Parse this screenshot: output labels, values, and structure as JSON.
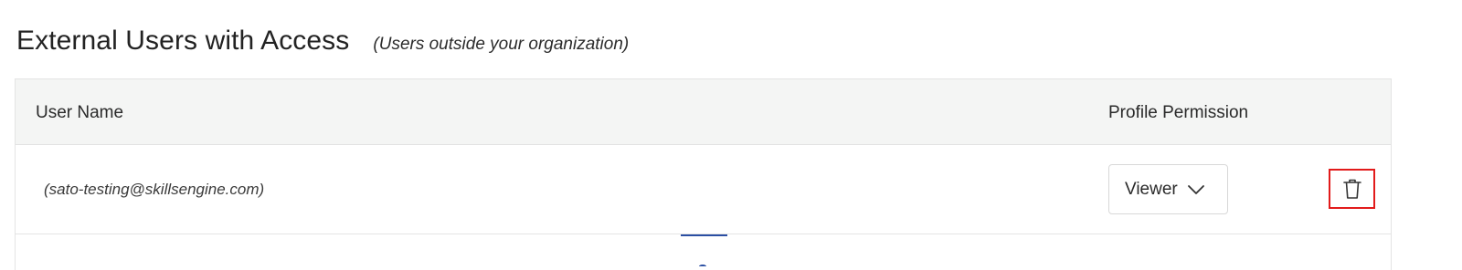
{
  "section": {
    "title": "External Users with Access",
    "subtitle": "(Users outside your organization)"
  },
  "table": {
    "columns": {
      "user_name": "User Name",
      "profile_permission": "Profile Permission"
    },
    "rows": [
      {
        "email": "(sato-testing@skillsengine.com)",
        "permission": "Viewer",
        "actions": {
          "delete_icon": "trash-icon"
        }
      }
    ]
  },
  "icons": {
    "dropdown": "chevron-down-icon",
    "delete": "trash-icon"
  },
  "colors": {
    "header_bg": "#f4f5f4",
    "highlight": "#e21b1b",
    "loader": "#2b4fa3"
  }
}
